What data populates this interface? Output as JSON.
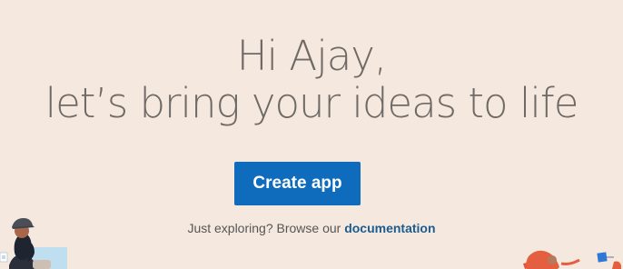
{
  "theme": {
    "background": "#f5e9df",
    "heading_color": "#6f6a66",
    "accent": "#0f6cbd",
    "link_color": "#1a5c8f"
  },
  "hero": {
    "greeting": "Hi Ajay,",
    "tagline": "let’s bring your ideas to life"
  },
  "cta": {
    "label": "Create app"
  },
  "explore": {
    "prefix": "Just exploring? Browse our ",
    "link_label": "documentation"
  },
  "illustrations": {
    "left": "person-with-cap-illustration",
    "right": "person-with-tablet-illustration"
  }
}
